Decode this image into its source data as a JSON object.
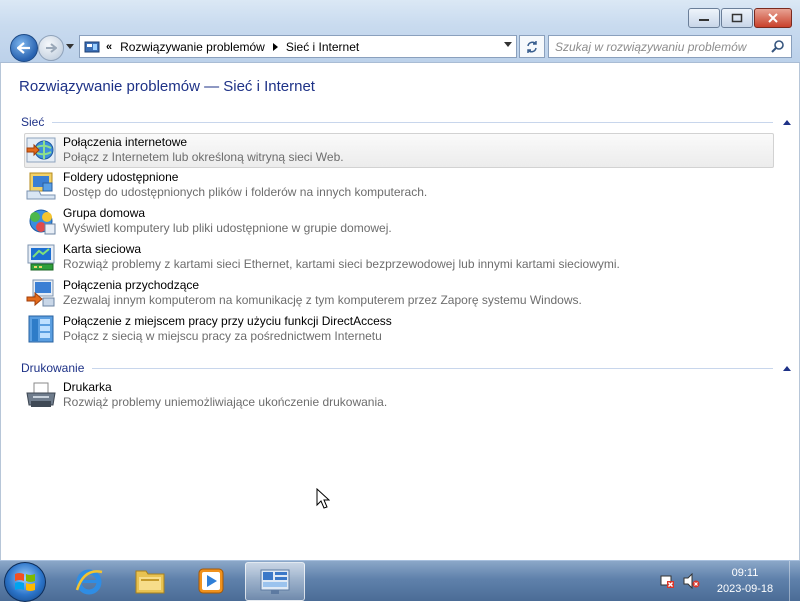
{
  "address_bar": {
    "overflow": "«",
    "crumbs": [
      "Rozwiązywanie problemów",
      "Sieć i Internet"
    ]
  },
  "search": {
    "placeholder": "Szukaj w rozwiązywaniu problemów"
  },
  "page_title": "Rozwiązywanie problemów — Sieć i Internet",
  "groups": [
    {
      "title": "Sieć",
      "items": [
        {
          "title": "Połączenia internetowe",
          "desc": "Połącz z Internetem lub określoną witryną sieci Web.",
          "icon": "internet-connections-icon"
        },
        {
          "title": "Foldery udostępnione",
          "desc": "Dostęp do udostępnionych plików i folderów na innych komputerach.",
          "icon": "shared-folders-icon"
        },
        {
          "title": "Grupa domowa",
          "desc": "Wyświetl komputery lub pliki udostępnione w grupie domowej.",
          "icon": "homegroup-icon"
        },
        {
          "title": "Karta sieciowa",
          "desc": "Rozwiąż problemy z kartami sieci Ethernet, kartami sieci bezprzewodowej lub innymi kartami sieciowymi.",
          "icon": "network-adapter-icon"
        },
        {
          "title": "Połączenia przychodzące",
          "desc": "Zezwalaj innym komputerom na komunikację z tym komputerem przez Zaporę systemu Windows.",
          "icon": "incoming-connections-icon"
        },
        {
          "title": "Połączenie z miejscem pracy przy użyciu funkcji DirectAccess",
          "desc": "Połącz z siecią w miejscu pracy za pośrednictwem Internetu",
          "icon": "directaccess-icon"
        }
      ]
    },
    {
      "title": "Drukowanie",
      "items": [
        {
          "title": "Drukarka",
          "desc": "Rozwiąż problemy uniemożliwiające ukończenie drukowania.",
          "icon": "printer-icon"
        }
      ]
    }
  ],
  "taskbar": {
    "apps": [
      "internet-explorer-icon",
      "windows-explorer-icon",
      "media-player-icon",
      "troubleshooting-icon"
    ],
    "clock": {
      "time": "09:11",
      "date": "2023-09-18"
    }
  },
  "colors": {
    "title_blue": "#1e3287",
    "taskbar": "#5f81ab"
  }
}
